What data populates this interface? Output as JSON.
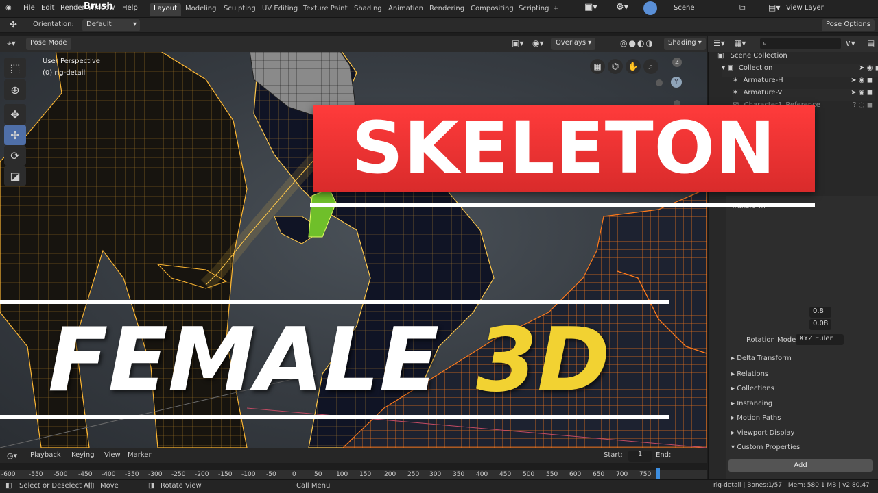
{
  "app": {
    "menu": [
      "File",
      "Edit",
      "Render",
      "Window",
      "Help"
    ],
    "overlay_brand": "Brush",
    "workspaces": [
      "Layout",
      "Modeling",
      "Sculpting",
      "UV Editing",
      "Texture Paint",
      "Shading",
      "Animation",
      "Rendering",
      "Compositing",
      "Scripting"
    ],
    "add_workspace": "+",
    "scene_label": "Scene",
    "view_layer_label": "View Layer"
  },
  "toolbar_row": {
    "orientation_label": "Orientation:",
    "orientation_value": "Default",
    "pose_options": "Pose Options"
  },
  "viewport_header": {
    "mode": "Pose Mode",
    "overlays": "Overlays",
    "shading": "Shading"
  },
  "viewport_info": {
    "line1": "User Perspective",
    "line2": "(0) rig-detail"
  },
  "outliner": {
    "search_placeholder": "",
    "rows": [
      {
        "label": "Scene Collection"
      },
      {
        "label": "Collection"
      },
      {
        "label": "Armature-H"
      },
      {
        "label": "Armature-V"
      },
      {
        "label": "Character1_Reference"
      }
    ]
  },
  "properties": {
    "section_transform": "Transform",
    "value1": "0.8",
    "value2": "0.08",
    "rotation_mode_label": "Rotation Mode",
    "rotation_mode_value": "XYZ Euler",
    "delta_transform": "Delta Transform",
    "relations": "Relations",
    "collections": "Collections",
    "instancing": "Instancing",
    "motion_paths": "Motion Paths",
    "viewport_display": "Viewport Display",
    "custom_properties": "Custom Properties",
    "add": "Add"
  },
  "timeline": {
    "playback": "Playback",
    "keying": "Keying",
    "view": "View",
    "marker": "Marker",
    "start_label": "Start:",
    "start_value": "1",
    "end_label": "End:",
    "ticks": [
      "-600",
      "-550",
      "-500",
      "-450",
      "-400",
      "-350",
      "-300",
      "-250",
      "-200",
      "-150",
      "-100",
      "-50",
      "0",
      "50",
      "100",
      "150",
      "200",
      "250",
      "300",
      "350",
      "400",
      "450",
      "500",
      "550",
      "600",
      "650",
      "700",
      "750"
    ]
  },
  "status": {
    "select": "Select or Deselect All",
    "move": "Move",
    "rotate": "Rotate View",
    "call_menu": "Call Menu",
    "stats": "rig-detail | Bones:1/57 | Mem: 580.1 MB | v2.80.47"
  },
  "thumbnail": {
    "title_top": "SKELETON",
    "title_bottom_a": "FEMALE",
    "title_bottom_b": "3D"
  },
  "colors": {
    "accent_red": "#ff3b3b",
    "accent_yellow": "#f2d232",
    "wire_orange": "#ff7a1a",
    "wire_yellow": "#ffb833"
  }
}
